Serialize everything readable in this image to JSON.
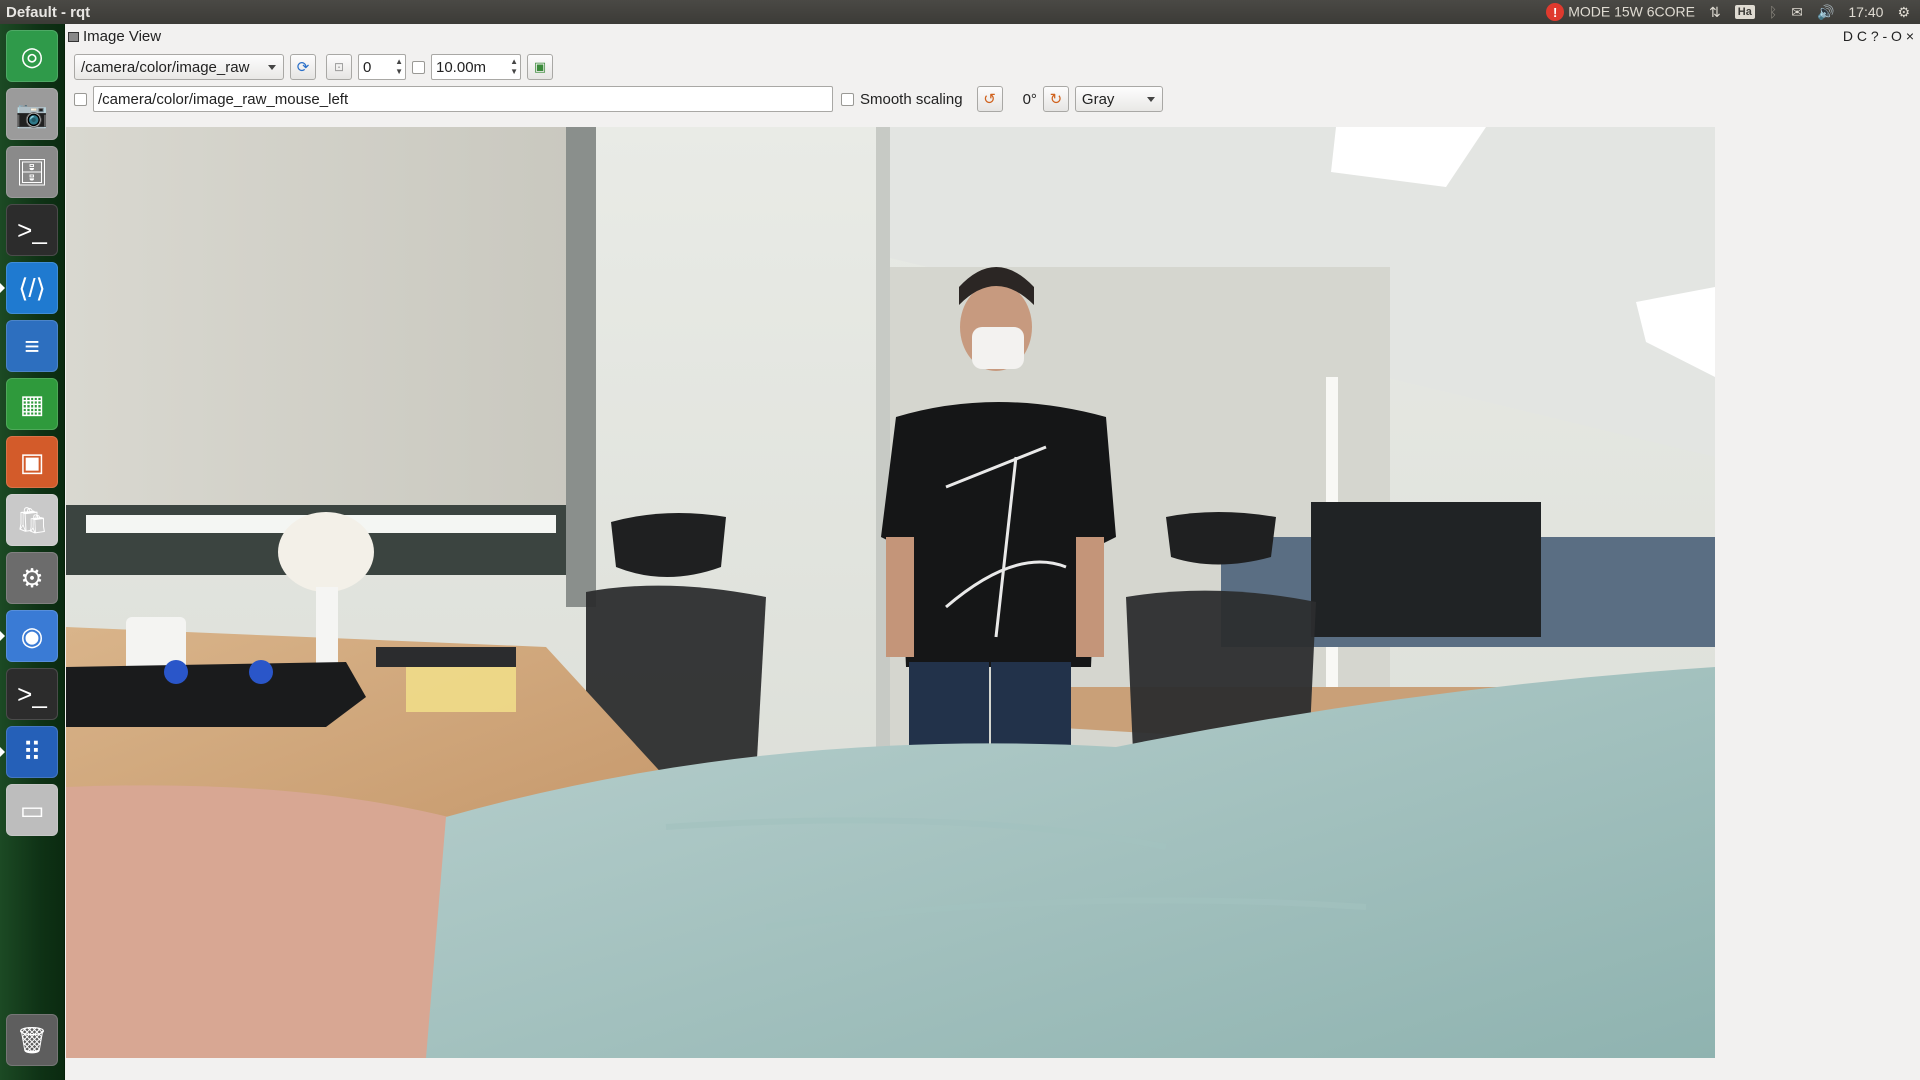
{
  "window": {
    "title": "Default - rqt"
  },
  "tray": {
    "mode": "MODE 15W 6CORE",
    "keyboard": "Ha",
    "time": "17:40"
  },
  "launcher": [
    {
      "name": "ubuntu-dash-icon",
      "glyph": "◎",
      "bg": "#2f9a4a"
    },
    {
      "name": "camera-app-icon",
      "glyph": "📷",
      "bg": "#9b9b9b"
    },
    {
      "name": "file-manager-icon",
      "glyph": "🗄",
      "bg": "#8a8a8a"
    },
    {
      "name": "terminal-icon",
      "glyph": ">_",
      "bg": "#2c2c2c"
    },
    {
      "name": "vscode-icon",
      "glyph": "⟨/⟩",
      "bg": "#1f7ad0"
    },
    {
      "name": "writer-icon",
      "glyph": "≡",
      "bg": "#2d6fbf"
    },
    {
      "name": "calc-icon",
      "glyph": "▦",
      "bg": "#2f9a3c"
    },
    {
      "name": "impress-icon",
      "glyph": "▣",
      "bg": "#d35b2a"
    },
    {
      "name": "software-center-icon",
      "glyph": "🛍",
      "bg": "#c9c9c9"
    },
    {
      "name": "settings-icon",
      "glyph": "⚙",
      "bg": "#6c6c6c"
    },
    {
      "name": "chromium-icon",
      "glyph": "◉",
      "bg": "#3a7bd5"
    },
    {
      "name": "terminal2-icon",
      "glyph": ">_",
      "bg": "#2c2c2c"
    },
    {
      "name": "app-grid-icon",
      "glyph": "⠿",
      "bg": "#2560b8"
    },
    {
      "name": "drive-icon",
      "glyph": "▭",
      "bg": "#bdbdbd"
    },
    {
      "name": "trash-icon",
      "glyph": "🗑",
      "bg": "#5e5e5e"
    }
  ],
  "dock": {
    "title": "Image View",
    "controls": "D C ? - O ×"
  },
  "toolbar": {
    "topic": "/camera/color/image_raw",
    "num_gridlines": "0",
    "max_depth": "10.00m",
    "mouse_topic": "/camera/color/image_raw_mouse_left",
    "smooth_scaling": "Smooth scaling",
    "rotation": "0°",
    "colormap": "Gray"
  }
}
